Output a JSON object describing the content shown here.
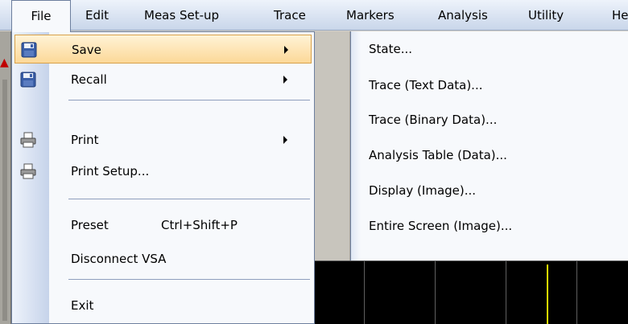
{
  "menubar": {
    "items": [
      "File",
      "Edit",
      "Meas Set-up",
      "Trace",
      "Markers",
      "Analysis",
      "Utility",
      "Hel"
    ]
  },
  "file_menu": {
    "items": [
      {
        "label": "Save",
        "icon": "save-icon",
        "submenu": true,
        "highlighted": true
      },
      {
        "label": "Recall",
        "icon": "save-icon",
        "submenu": true
      },
      {
        "label": "Print",
        "icon": "printer-icon",
        "submenu": true
      },
      {
        "label": "Print Setup...",
        "icon": "printer-icon"
      },
      {
        "label": "Preset",
        "shortcut": "Ctrl+Shift+P"
      },
      {
        "label": "Disconnect VSA"
      },
      {
        "label": "Exit"
      }
    ]
  },
  "save_submenu": {
    "items": [
      "State...",
      "Trace (Text Data)...",
      "Trace (Binary Data)...",
      "Analysis Table (Data)...",
      "Display (Image)...",
      "Entire Screen (Image)..."
    ]
  },
  "colors": {
    "highlight": "#fcd898",
    "menubar": "#c9d6ea",
    "trace": "#e6e600"
  }
}
